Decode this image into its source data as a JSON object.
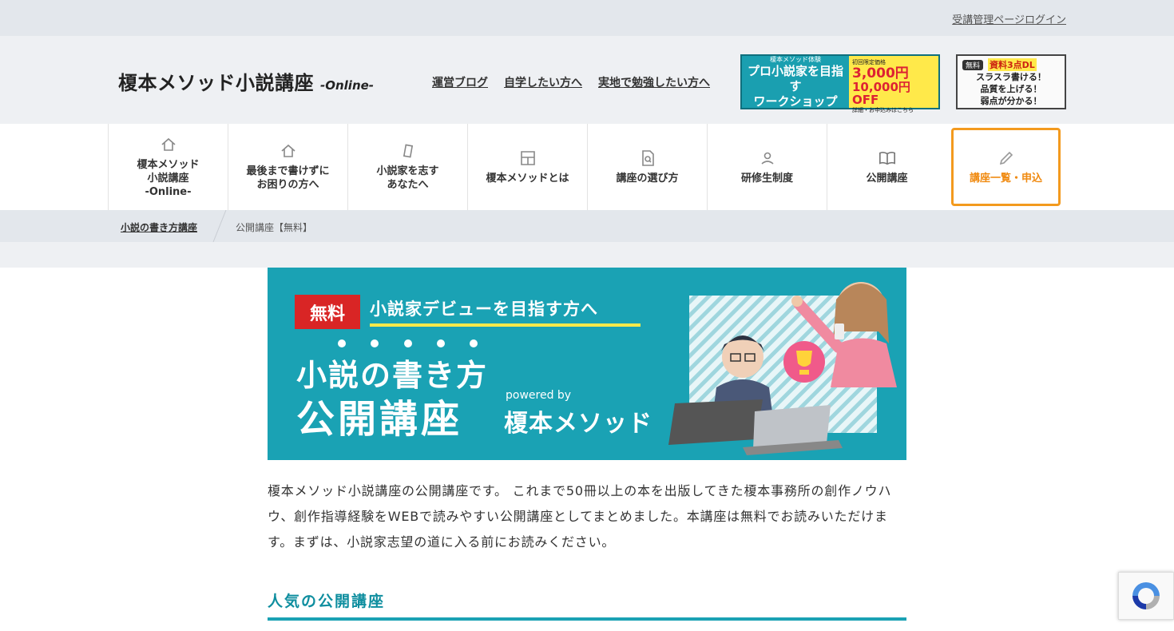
{
  "topbar": {
    "login_link": "受講管理ページログイン"
  },
  "header": {
    "logo_main": "榎本メソッド小説講座",
    "logo_sub": "-Online-",
    "links": [
      "運営ブログ",
      "自学したい方へ",
      "実地で勉強したい方へ"
    ],
    "banner_workshop": {
      "small": "榎本メソッド体験",
      "line1": "プロ小説家を目指す",
      "line2": "ワークショップ",
      "note1": "初回限定価格",
      "price": "3,000円",
      "off": "10,000円OFF",
      "note2": "詳細・お申込みはこちら"
    },
    "banner_dl": {
      "free": "無料",
      "dl": "資料3点DL",
      "lines": [
        "スラスラ書ける！",
        "品質を上げる！",
        "弱点が分かる！"
      ]
    }
  },
  "nav": {
    "items": [
      {
        "label": "榎本メソッド\n小説講座\n-Online-",
        "icon": "home-icon"
      },
      {
        "label": "最後まで書けずに\nお困りの方へ",
        "icon": "home-icon"
      },
      {
        "label": "小説家を志す\nあなたへ",
        "icon": "phone-icon"
      },
      {
        "label": "榎本メソッドとは",
        "icon": "layout-icon"
      },
      {
        "label": "講座の選び方",
        "icon": "document-search-icon"
      },
      {
        "label": "研修生制度",
        "icon": "person-icon"
      },
      {
        "label": "公開講座",
        "icon": "book-icon"
      },
      {
        "label": "講座一覧・申込",
        "icon": "pencil-icon",
        "active": true
      }
    ]
  },
  "breadcrumb": {
    "home": "小説の書き方講座",
    "current": "公開講座【無料】"
  },
  "hero": {
    "badge": "無料",
    "tag": "小説家デビューを目指す方へ",
    "title1": "小説の書き方",
    "title2": "公開講座",
    "powered": "powered by",
    "brand": "榎本メソッド"
  },
  "intro": "榎本メソッド小説講座の公開講座です。 これまで50冊以上の本を出版してきた榎本事務所の創作ノウハウ、創作指導経験をWEBで読みやすい公開講座としてまとめました。本講座は無料でお読みいただけます。まずは、小説家志望の道に入る前にお読みください。",
  "section": {
    "title": "人気の公開講座"
  },
  "colors": {
    "teal": "#1aa2b4",
    "orange": "#f39a1e",
    "yellow": "#ffe94a",
    "red": "#d92525"
  }
}
